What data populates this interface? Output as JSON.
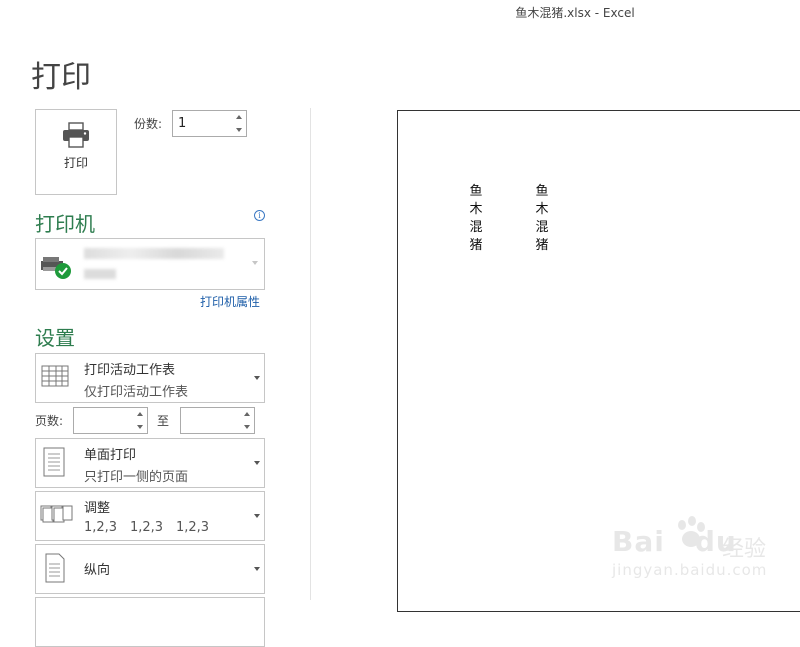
{
  "window": {
    "title": "鱼木混猪.xlsx - Excel"
  },
  "page": {
    "title": "打印"
  },
  "print_button": {
    "label": "打印"
  },
  "copies": {
    "label": "份数:",
    "value": "1"
  },
  "printer": {
    "heading": "打印机",
    "properties_link": "打印机属性"
  },
  "settings": {
    "heading": "设置",
    "print_what": {
      "title": "打印活动工作表",
      "subtitle": "仅打印活动工作表"
    },
    "pages": {
      "label": "页数:",
      "from": "",
      "to_label": "至",
      "to": ""
    },
    "sides": {
      "title": "单面打印",
      "subtitle": "只打印一侧的页面"
    },
    "collate": {
      "title": "调整",
      "sequence": [
        "1,2,3",
        "1,2,3",
        "1,2,3"
      ]
    },
    "orientation": {
      "title": "纵向"
    }
  },
  "preview": {
    "columns": [
      [
        "鱼",
        "木",
        "混",
        "猪"
      ],
      [
        "鱼",
        "木",
        "混",
        "猪"
      ]
    ]
  },
  "watermark": {
    "brand_latin": "Bai",
    "brand_latin_end": "du",
    "brand_cn": "经验",
    "url": "jingyan.baidu.com"
  }
}
